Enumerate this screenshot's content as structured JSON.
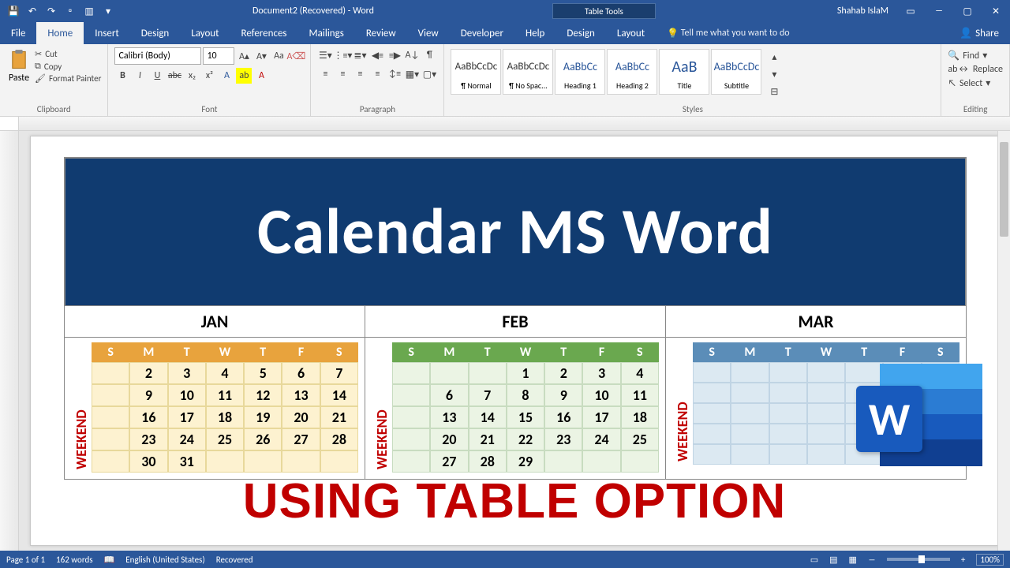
{
  "titlebar": {
    "title": "Document2 (Recovered) - Word",
    "tabletools": "Table Tools",
    "user": "Shahab IslaM"
  },
  "tabs": {
    "file": "File",
    "home": "Home",
    "insert": "Insert",
    "design": "Design",
    "layout": "Layout",
    "references": "References",
    "mailings": "Mailings",
    "review": "Review",
    "view": "View",
    "developer": "Developer",
    "help": "Help",
    "tt_design": "Design",
    "tt_layout": "Layout",
    "tell": "Tell me what you want to do",
    "share": "Share"
  },
  "ribbon": {
    "clipboard": {
      "label": "Clipboard",
      "paste": "Paste",
      "cut": "Cut",
      "copy": "Copy",
      "formatpainter": "Format Painter"
    },
    "font": {
      "label": "Font",
      "name": "Calibri (Body)",
      "size": "10"
    },
    "paragraph": {
      "label": "Paragraph"
    },
    "styles": {
      "label": "Styles",
      "s1": "¶ Normal",
      "s2": "¶ No Spac...",
      "s3": "Heading 1",
      "s4": "Heading 2",
      "s5": "Title",
      "s6": "Subtitle",
      "prev": "AaBbCcDc",
      "prevh": "AaBbCc",
      "prevt": "AaB"
    },
    "editing": {
      "label": "Editing",
      "find": "Find",
      "replace": "Replace",
      "select": "Select"
    }
  },
  "doc": {
    "banner": "Calendar MS Word",
    "overlay": "USING TABLE OPTION",
    "days": [
      "S",
      "M",
      "T",
      "W",
      "T",
      "F",
      "S"
    ],
    "weekend": "WEEKEND",
    "months": {
      "jan": {
        "name": "JAN",
        "rows": [
          [
            "",
            "2",
            "3",
            "4",
            "5",
            "6",
            "7"
          ],
          [
            "",
            "9",
            "10",
            "11",
            "12",
            "13",
            "14"
          ],
          [
            "",
            "16",
            "17",
            "18",
            "19",
            "20",
            "21"
          ],
          [
            "",
            "23",
            "24",
            "25",
            "26",
            "27",
            "28"
          ],
          [
            "",
            "30",
            "31",
            "",
            "",
            "",
            ""
          ]
        ]
      },
      "feb": {
        "name": "FEB",
        "rows": [
          [
            "",
            "",
            "",
            "1",
            "2",
            "3",
            "4"
          ],
          [
            "",
            "6",
            "7",
            "8",
            "9",
            "10",
            "11"
          ],
          [
            "",
            "13",
            "14",
            "15",
            "16",
            "17",
            "18"
          ],
          [
            "",
            "20",
            "21",
            "22",
            "23",
            "24",
            "25"
          ],
          [
            "",
            "27",
            "28",
            "29",
            "",
            "",
            ""
          ]
        ]
      },
      "mar": {
        "name": "MAR"
      }
    }
  },
  "status": {
    "page": "Page 1 of 1",
    "words": "162 words",
    "lang": "English (United States)",
    "recovered": "Recovered",
    "zoom": "100%"
  }
}
